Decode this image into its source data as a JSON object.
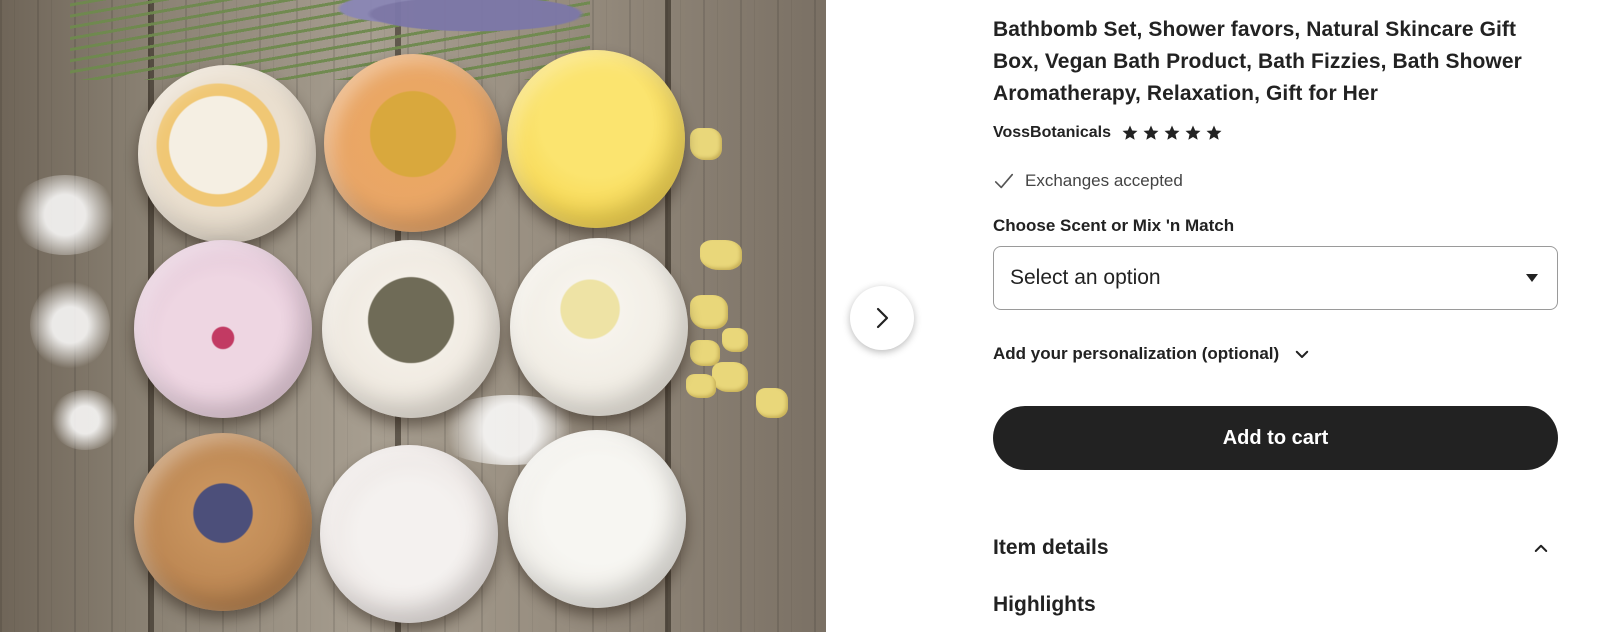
{
  "product": {
    "title": "Bathbomb Set, Shower favors, Natural Skincare Gift Box, Vegan Bath Product, Bath Fizzies, Bath Shower Aromatherapy, Relaxation, Gift for Her",
    "shop_name": "VossBotanicals",
    "rating_stars": 5,
    "exchange_text": "Exchanges accepted"
  },
  "photo": {
    "alt": "Bath bombs on wooden table",
    "next_icon": "chevron-right-icon"
  },
  "variation": {
    "label": "Choose Scent or Mix 'n Match",
    "selected": "Select an option",
    "dropdown_icon": "caret-down-icon"
  },
  "personalization": {
    "label": "Add your personalization (optional)",
    "icon": "chevron-down-icon"
  },
  "cart": {
    "label": "Add to cart"
  },
  "details": {
    "label": "Item details",
    "icon": "chevron-up-icon",
    "highlights_label": "Highlights"
  },
  "colors": {
    "text": "#222222",
    "button_bg": "#222222",
    "button_text": "#ffffff",
    "border": "#9a9a9a",
    "star": "#222222"
  }
}
